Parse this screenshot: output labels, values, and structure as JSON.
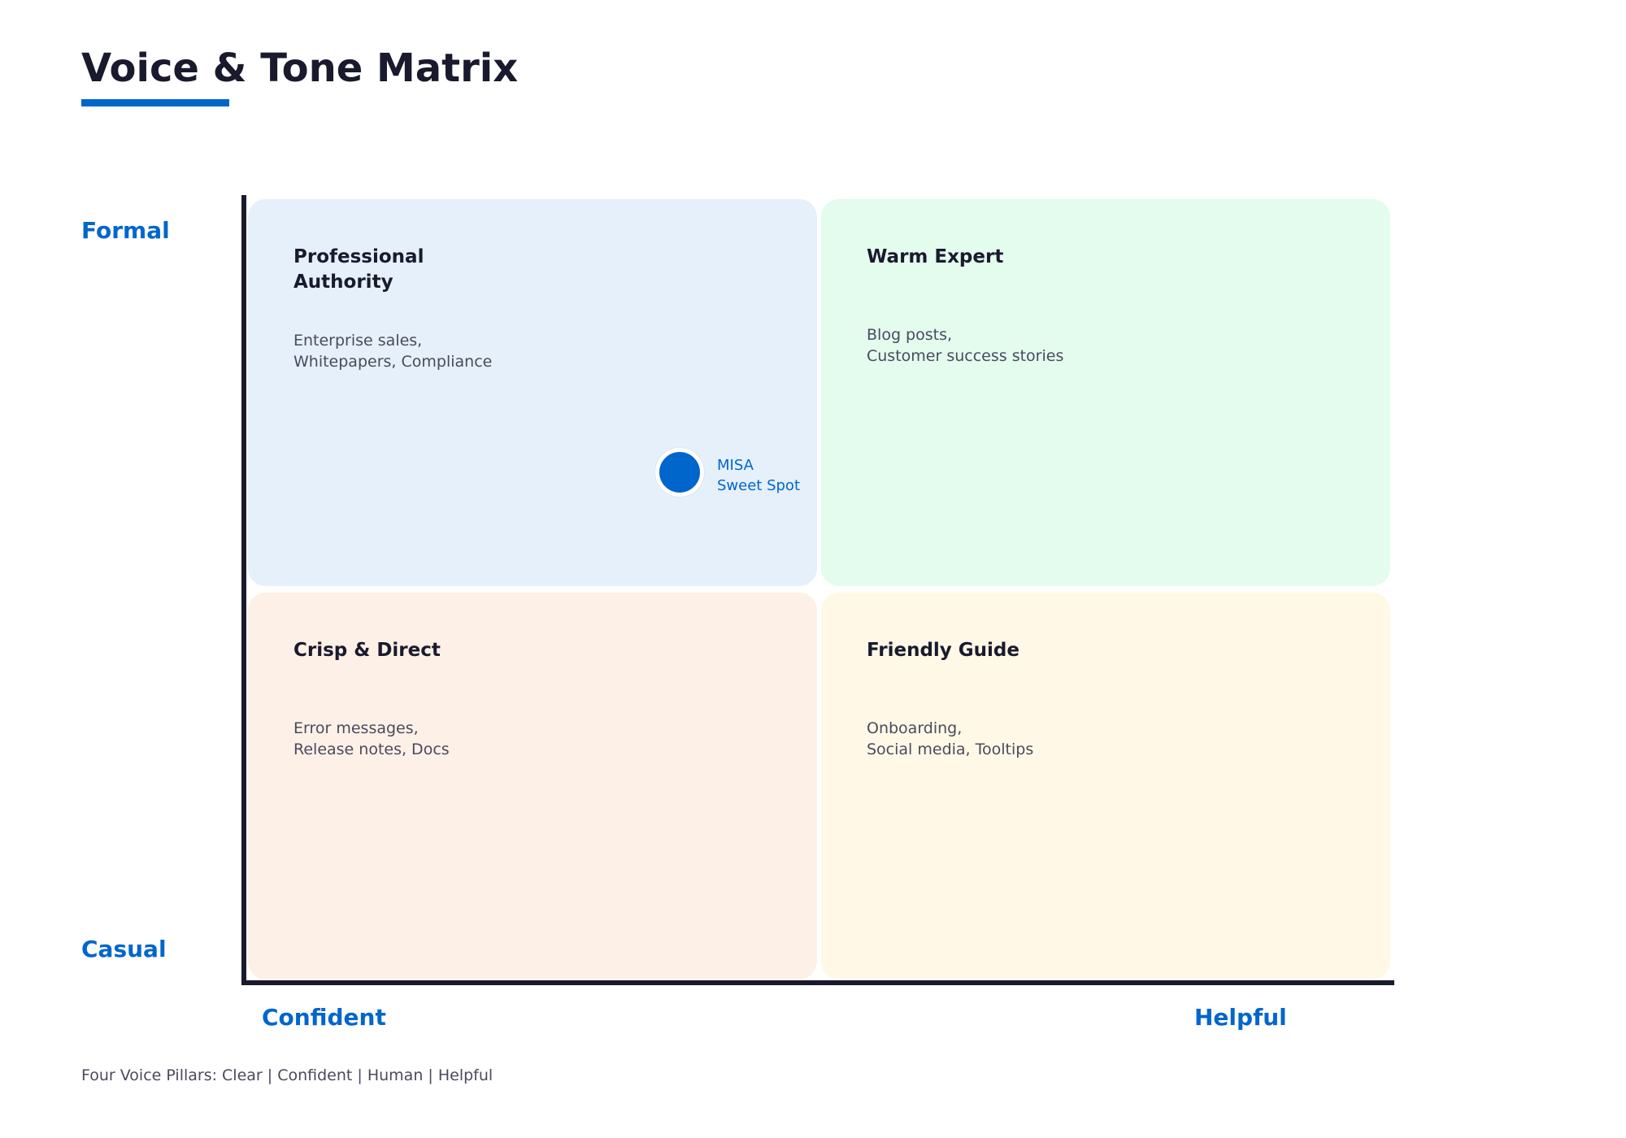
{
  "title": "Voice & Tone Matrix",
  "colors": {
    "accent": "#0066cc",
    "axis": "#1a1a2e",
    "heading": "#1a1a2e",
    "body_text": "#4a4a5e"
  },
  "axes": {
    "y_top": "Formal",
    "y_bottom": "Casual",
    "x_left": "Confident",
    "x_right": "Helpful"
  },
  "quadrants": {
    "top_left": {
      "title_lines": [
        "Professional",
        "Authority"
      ],
      "use_lines": [
        "Enterprise sales,",
        "Whitepapers, Compliance"
      ],
      "color": "#e5f0fa"
    },
    "top_right": {
      "title_lines": [
        "Warm Expert"
      ],
      "use_lines": [
        "Blog posts,",
        "Customer success stories"
      ],
      "color": "#e3fcee"
    },
    "bottom_left": {
      "title_lines": [
        "Crisp & Direct"
      ],
      "use_lines": [
        "Error messages,",
        "Release notes, Docs"
      ],
      "color": "#fdf0e6"
    },
    "bottom_right": {
      "title_lines": [
        "Friendly Guide"
      ],
      "use_lines": [
        "Onboarding,",
        "Social media, Tooltips"
      ],
      "color": "#fff8e6"
    }
  },
  "marker": {
    "label_lines": [
      "MISA",
      "Sweet Spot"
    ],
    "color": "#0066cc"
  },
  "footer": "Four Voice Pillars: Clear | Confident | Human | Helpful"
}
